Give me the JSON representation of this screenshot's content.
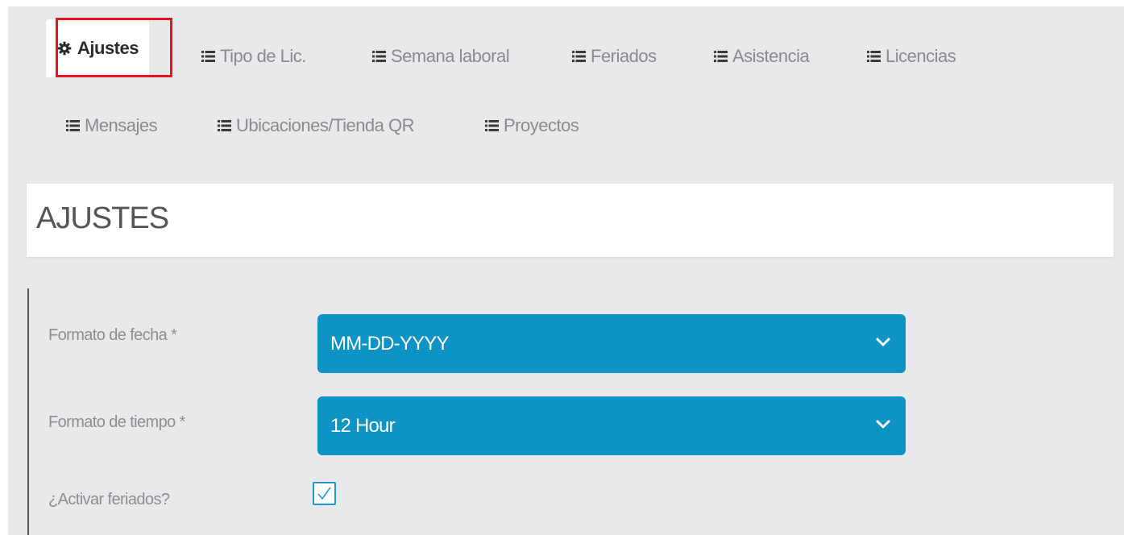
{
  "tabs_row1": [
    {
      "label": "Ajustes",
      "icon": "gear-icon",
      "active": true
    },
    {
      "label": "Tipo de Lic.",
      "icon": "list-icon"
    },
    {
      "label": "Semana laboral",
      "icon": "list-icon"
    },
    {
      "label": "Feriados",
      "icon": "list-icon"
    },
    {
      "label": "Asistencia",
      "icon": "list-icon"
    },
    {
      "label": "Licencias",
      "icon": "list-icon"
    }
  ],
  "tabs_row2": [
    {
      "label": "Mensajes",
      "icon": "list-icon"
    },
    {
      "label": "Ubicaciones/Tienda QR",
      "icon": "list-icon"
    },
    {
      "label": "Proyectos",
      "icon": "list-icon"
    }
  ],
  "page": {
    "title": "AJUSTES"
  },
  "form": {
    "date_format": {
      "label": "Formato de fecha *",
      "value": "MM-DD-YYYY"
    },
    "time_format": {
      "label": "Formato de tiempo *",
      "value": "12 Hour"
    },
    "holidays": {
      "label": "¿Activar feriados?",
      "checked": true
    }
  },
  "colors": {
    "background": "#e9e9eb",
    "select_bg": "#0e93c5",
    "highlight": "#e8151c",
    "checkbox_border": "#1e9ad0"
  }
}
